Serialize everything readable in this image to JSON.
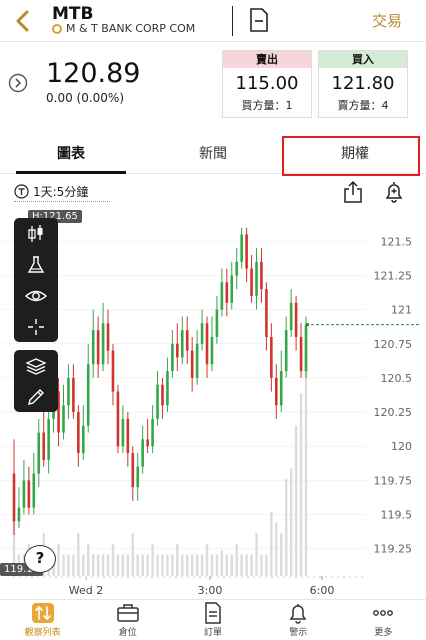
{
  "header": {
    "ticker": "MTB",
    "company": "M & T BANK CORP COM",
    "trade_label": "交易"
  },
  "quote": {
    "price": "120.89",
    "change": "0.00 (0.00%)",
    "sell": {
      "title": "賣出",
      "price": "115.00",
      "volume": "買方量：1"
    },
    "buy": {
      "title": "買入",
      "price": "121.80",
      "volume": "賣方量：4"
    }
  },
  "tabs": [
    {
      "label": "圖表",
      "active": true
    },
    {
      "label": "新聞",
      "active": false
    },
    {
      "label": "期權",
      "active": false
    }
  ],
  "chart_toolbar": {
    "interval": "1天:5分鐘"
  },
  "chart_data": {
    "type": "candlestick",
    "y_ticks": [
      "121.5",
      "121.25",
      "121",
      "120.75",
      "120.5",
      "120.25",
      "120",
      "119.75",
      "119.5",
      "119.25"
    ],
    "x_ticks": [
      "Wed 2",
      "3:00",
      "6:00"
    ],
    "ylim": [
      119.05,
      121.7
    ],
    "high_label": "121.65",
    "low_label": "119.18",
    "last_price": 120.89,
    "colors": {
      "up": "#33a84a",
      "down": "#d0342c",
      "volume": "#dcdcdc",
      "last_line": "#2e8b3e"
    },
    "candles": [
      [
        119.8,
        119.45,
        120.05,
        119.35
      ],
      [
        119.45,
        119.55,
        119.7,
        119.4
      ],
      [
        119.55,
        119.75,
        119.9,
        119.5
      ],
      [
        119.75,
        119.55,
        119.85,
        119.5
      ],
      [
        119.55,
        119.8,
        119.95,
        119.5
      ],
      [
        119.8,
        120.1,
        120.2,
        119.7
      ],
      [
        120.1,
        119.9,
        120.25,
        119.85
      ],
      [
        119.9,
        120.2,
        120.3,
        119.8
      ],
      [
        120.2,
        120.4,
        120.55,
        120.1
      ],
      [
        120.4,
        120.1,
        120.5,
        120.0
      ],
      [
        120.1,
        120.3,
        120.45,
        120.05
      ],
      [
        120.3,
        120.5,
        120.6,
        120.2
      ],
      [
        120.5,
        120.25,
        120.6,
        120.2
      ],
      [
        120.25,
        119.95,
        120.3,
        119.85
      ],
      [
        119.95,
        120.15,
        120.3,
        119.9
      ],
      [
        120.15,
        120.6,
        120.75,
        120.1
      ],
      [
        120.6,
        120.85,
        121.0,
        120.5
      ],
      [
        120.85,
        120.6,
        120.95,
        120.5
      ],
      [
        120.6,
        120.9,
        121.05,
        120.55
      ],
      [
        120.9,
        120.7,
        121.0,
        120.6
      ],
      [
        120.7,
        120.4,
        120.75,
        120.3
      ],
      [
        120.4,
        120.0,
        120.45,
        119.95
      ],
      [
        120.0,
        120.2,
        120.3,
        119.95
      ],
      [
        120.2,
        119.95,
        120.25,
        119.85
      ],
      [
        119.95,
        119.7,
        120.0,
        119.6
      ],
      [
        119.7,
        119.85,
        119.95,
        119.6
      ],
      [
        119.85,
        120.05,
        120.15,
        119.8
      ],
      [
        120.05,
        120.0,
        120.2,
        119.95
      ],
      [
        120.0,
        120.2,
        120.3,
        119.95
      ],
      [
        120.2,
        120.45,
        120.55,
        120.15
      ],
      [
        120.45,
        120.3,
        120.5,
        120.2
      ],
      [
        120.3,
        120.55,
        120.65,
        120.25
      ],
      [
        120.55,
        120.75,
        120.85,
        120.5
      ],
      [
        120.75,
        120.65,
        120.9,
        120.55
      ],
      [
        120.65,
        120.85,
        120.95,
        120.6
      ],
      [
        120.85,
        120.7,
        120.95,
        120.6
      ],
      [
        120.7,
        120.5,
        120.8,
        120.4
      ],
      [
        120.5,
        120.75,
        120.85,
        120.45
      ],
      [
        120.75,
        120.9,
        121.0,
        120.7
      ],
      [
        120.9,
        120.6,
        120.95,
        120.5
      ],
      [
        120.6,
        120.8,
        120.95,
        120.55
      ],
      [
        120.8,
        121.0,
        121.1,
        120.75
      ],
      [
        121.0,
        121.2,
        121.3,
        120.95
      ],
      [
        121.2,
        121.05,
        121.3,
        120.95
      ],
      [
        121.05,
        121.25,
        121.35,
        121.0
      ],
      [
        121.25,
        121.35,
        121.45,
        121.15
      ],
      [
        121.35,
        121.55,
        121.6,
        121.3
      ],
      [
        121.55,
        121.3,
        121.6,
        121.2
      ],
      [
        121.3,
        121.1,
        121.4,
        121.05
      ],
      [
        121.1,
        121.35,
        121.45,
        121.0
      ],
      [
        121.35,
        121.15,
        121.45,
        121.05
      ],
      [
        121.15,
        120.8,
        121.2,
        120.7
      ],
      [
        120.8,
        120.5,
        120.9,
        120.4
      ],
      [
        120.5,
        120.3,
        120.6,
        120.2
      ],
      [
        120.3,
        120.55,
        120.7,
        120.25
      ],
      [
        120.55,
        120.85,
        120.95,
        120.5
      ],
      [
        120.85,
        121.05,
        121.15,
        120.8
      ],
      [
        121.05,
        120.8,
        121.1,
        120.7
      ],
      [
        120.8,
        120.55,
        120.9,
        120.5
      ],
      [
        120.55,
        120.89,
        120.95,
        120.5
      ]
    ],
    "volumes": [
      0.3,
      0.1,
      0.1,
      0.15,
      0.1,
      0.1,
      0.2,
      0.1,
      0.1,
      0.15,
      0.1,
      0.1,
      0.1,
      0.2,
      0.1,
      0.15,
      0.1,
      0.1,
      0.1,
      0.1,
      0.15,
      0.1,
      0.1,
      0.1,
      0.2,
      0.1,
      0.1,
      0.1,
      0.15,
      0.1,
      0.1,
      0.1,
      0.1,
      0.15,
      0.1,
      0.1,
      0.1,
      0.1,
      0.1,
      0.15,
      0.1,
      0.1,
      0.12,
      0.1,
      0.1,
      0.15,
      0.1,
      0.1,
      0.1,
      0.2,
      0.1,
      0.1,
      0.3,
      0.25,
      0.2,
      0.45,
      0.5,
      0.7,
      0.85,
      1.0
    ]
  },
  "bottom_nav": [
    {
      "label": "觀察列表",
      "icon": "arrows-updown-icon",
      "active": true
    },
    {
      "label": "倉位",
      "icon": "briefcase-icon",
      "active": false
    },
    {
      "label": "訂單",
      "icon": "document-icon",
      "active": false
    },
    {
      "label": "警示",
      "icon": "bell-icon",
      "active": false
    },
    {
      "label": "更多",
      "icon": "more-icon",
      "active": false
    }
  ]
}
